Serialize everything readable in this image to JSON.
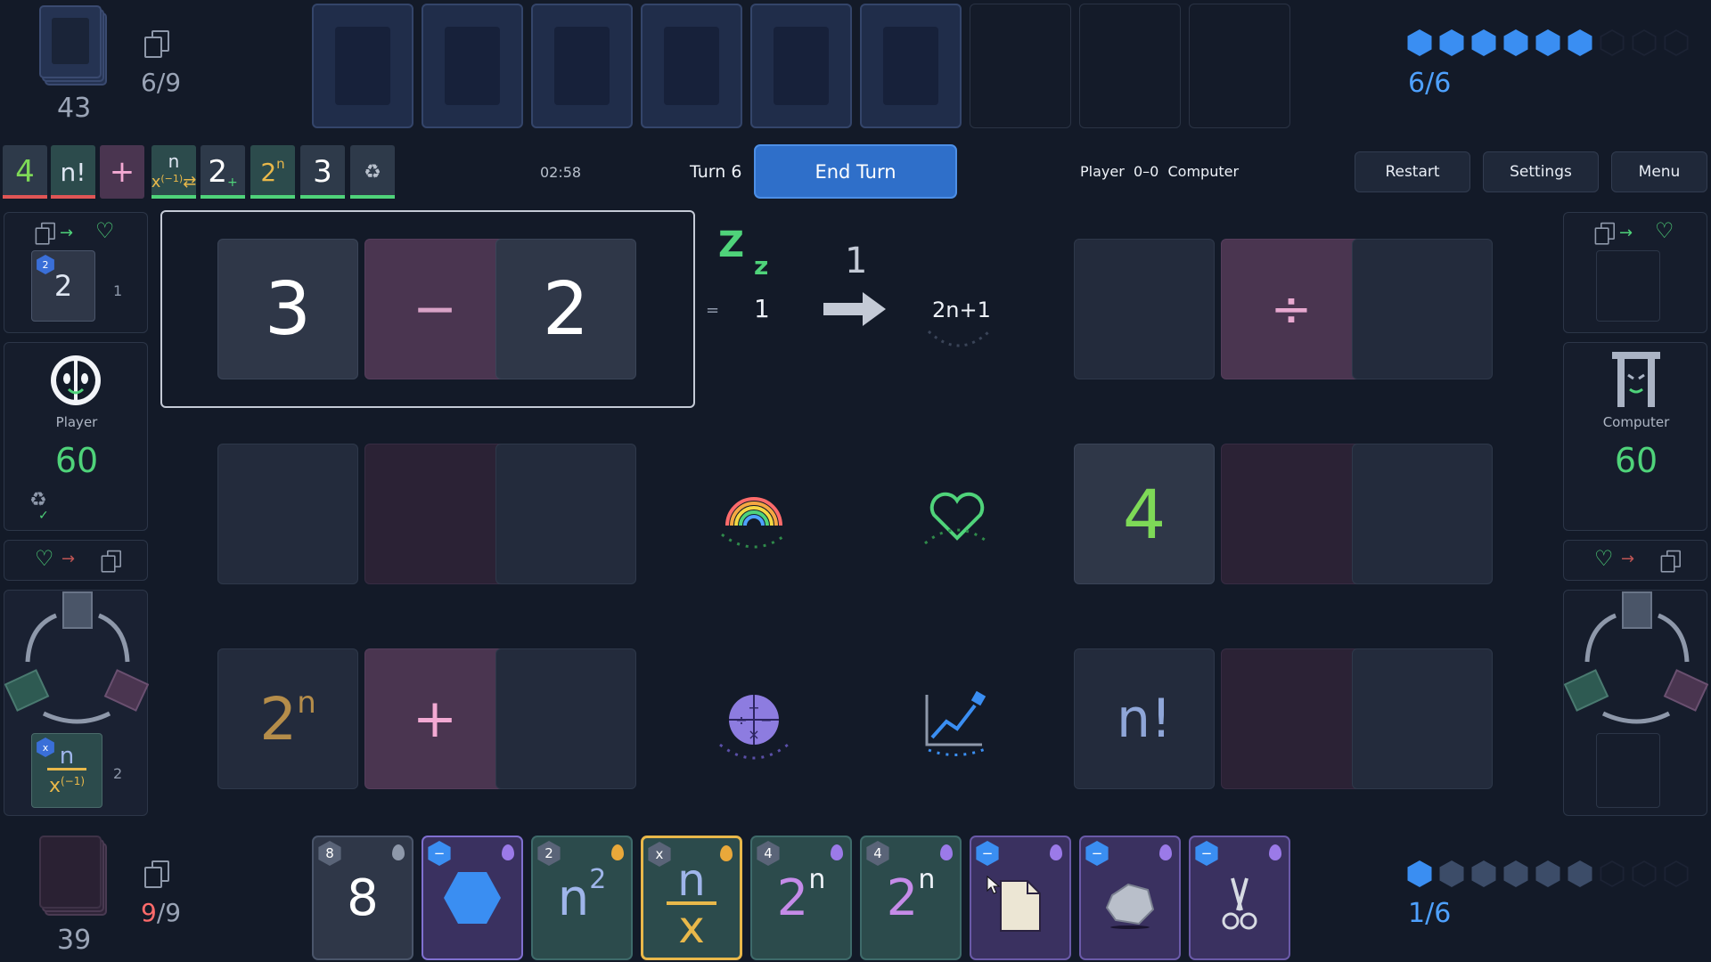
{
  "player_deck": {
    "deck_count": "43",
    "hand_count": "6/9"
  },
  "opponent_deck": {
    "deck_count": "39",
    "hand_current": "9",
    "hand_max": "/9"
  },
  "mana_top": {
    "value": "6/6",
    "filled": 6,
    "max": 9
  },
  "mana_bottom": {
    "value": "1/6",
    "filled": 1,
    "max": 9
  },
  "toolbar": {
    "pills": [
      "4",
      "n!",
      "+",
      "2",
      "2",
      "3"
    ],
    "timer": "02:58",
    "turn": "Turn 6",
    "end_turn": "End Turn",
    "score": "Player  0–0  Computer",
    "restart": "Restart",
    "settings": "Settings",
    "menu": "Menu"
  },
  "player": {
    "name": "Player",
    "hp": "60",
    "discard_card_value": "2",
    "discard_count": "1",
    "discard_card_badge": "2",
    "cycle_card_count": "2",
    "cycle_badge": "x"
  },
  "computer": {
    "name": "Computer",
    "hp": "60"
  },
  "board": {
    "left": {
      "row1": [
        "3",
        "−",
        "2"
      ],
      "row2": [
        "",
        "",
        ""
      ],
      "row3": [
        "2",
        "+",
        ""
      ]
    },
    "right": {
      "row1": [
        "",
        "÷",
        ""
      ],
      "row2": [
        "4",
        "",
        ""
      ],
      "row3": [
        "n!",
        "",
        ""
      ]
    },
    "equation": {
      "equals": "=",
      "result": "1",
      "arrow_value": "1",
      "formula": "2n+1"
    }
  },
  "hand": [
    {
      "badge": "8",
      "value": "8"
    },
    {
      "badge": "−",
      "value": ""
    },
    {
      "badge": "2",
      "value": "n"
    },
    {
      "badge": "x",
      "value": "n"
    },
    {
      "badge": "4",
      "value": "2"
    },
    {
      "badge": "4",
      "value": "2"
    },
    {
      "badge": "−",
      "value": ""
    },
    {
      "badge": "−",
      "value": ""
    },
    {
      "badge": "−",
      "value": ""
    }
  ],
  "colors": {
    "accent": "#2f6fc9",
    "hp_green": "#4fd37a",
    "mana_blue": "#3a8ef2",
    "warn_red": "#ff6b6b"
  }
}
